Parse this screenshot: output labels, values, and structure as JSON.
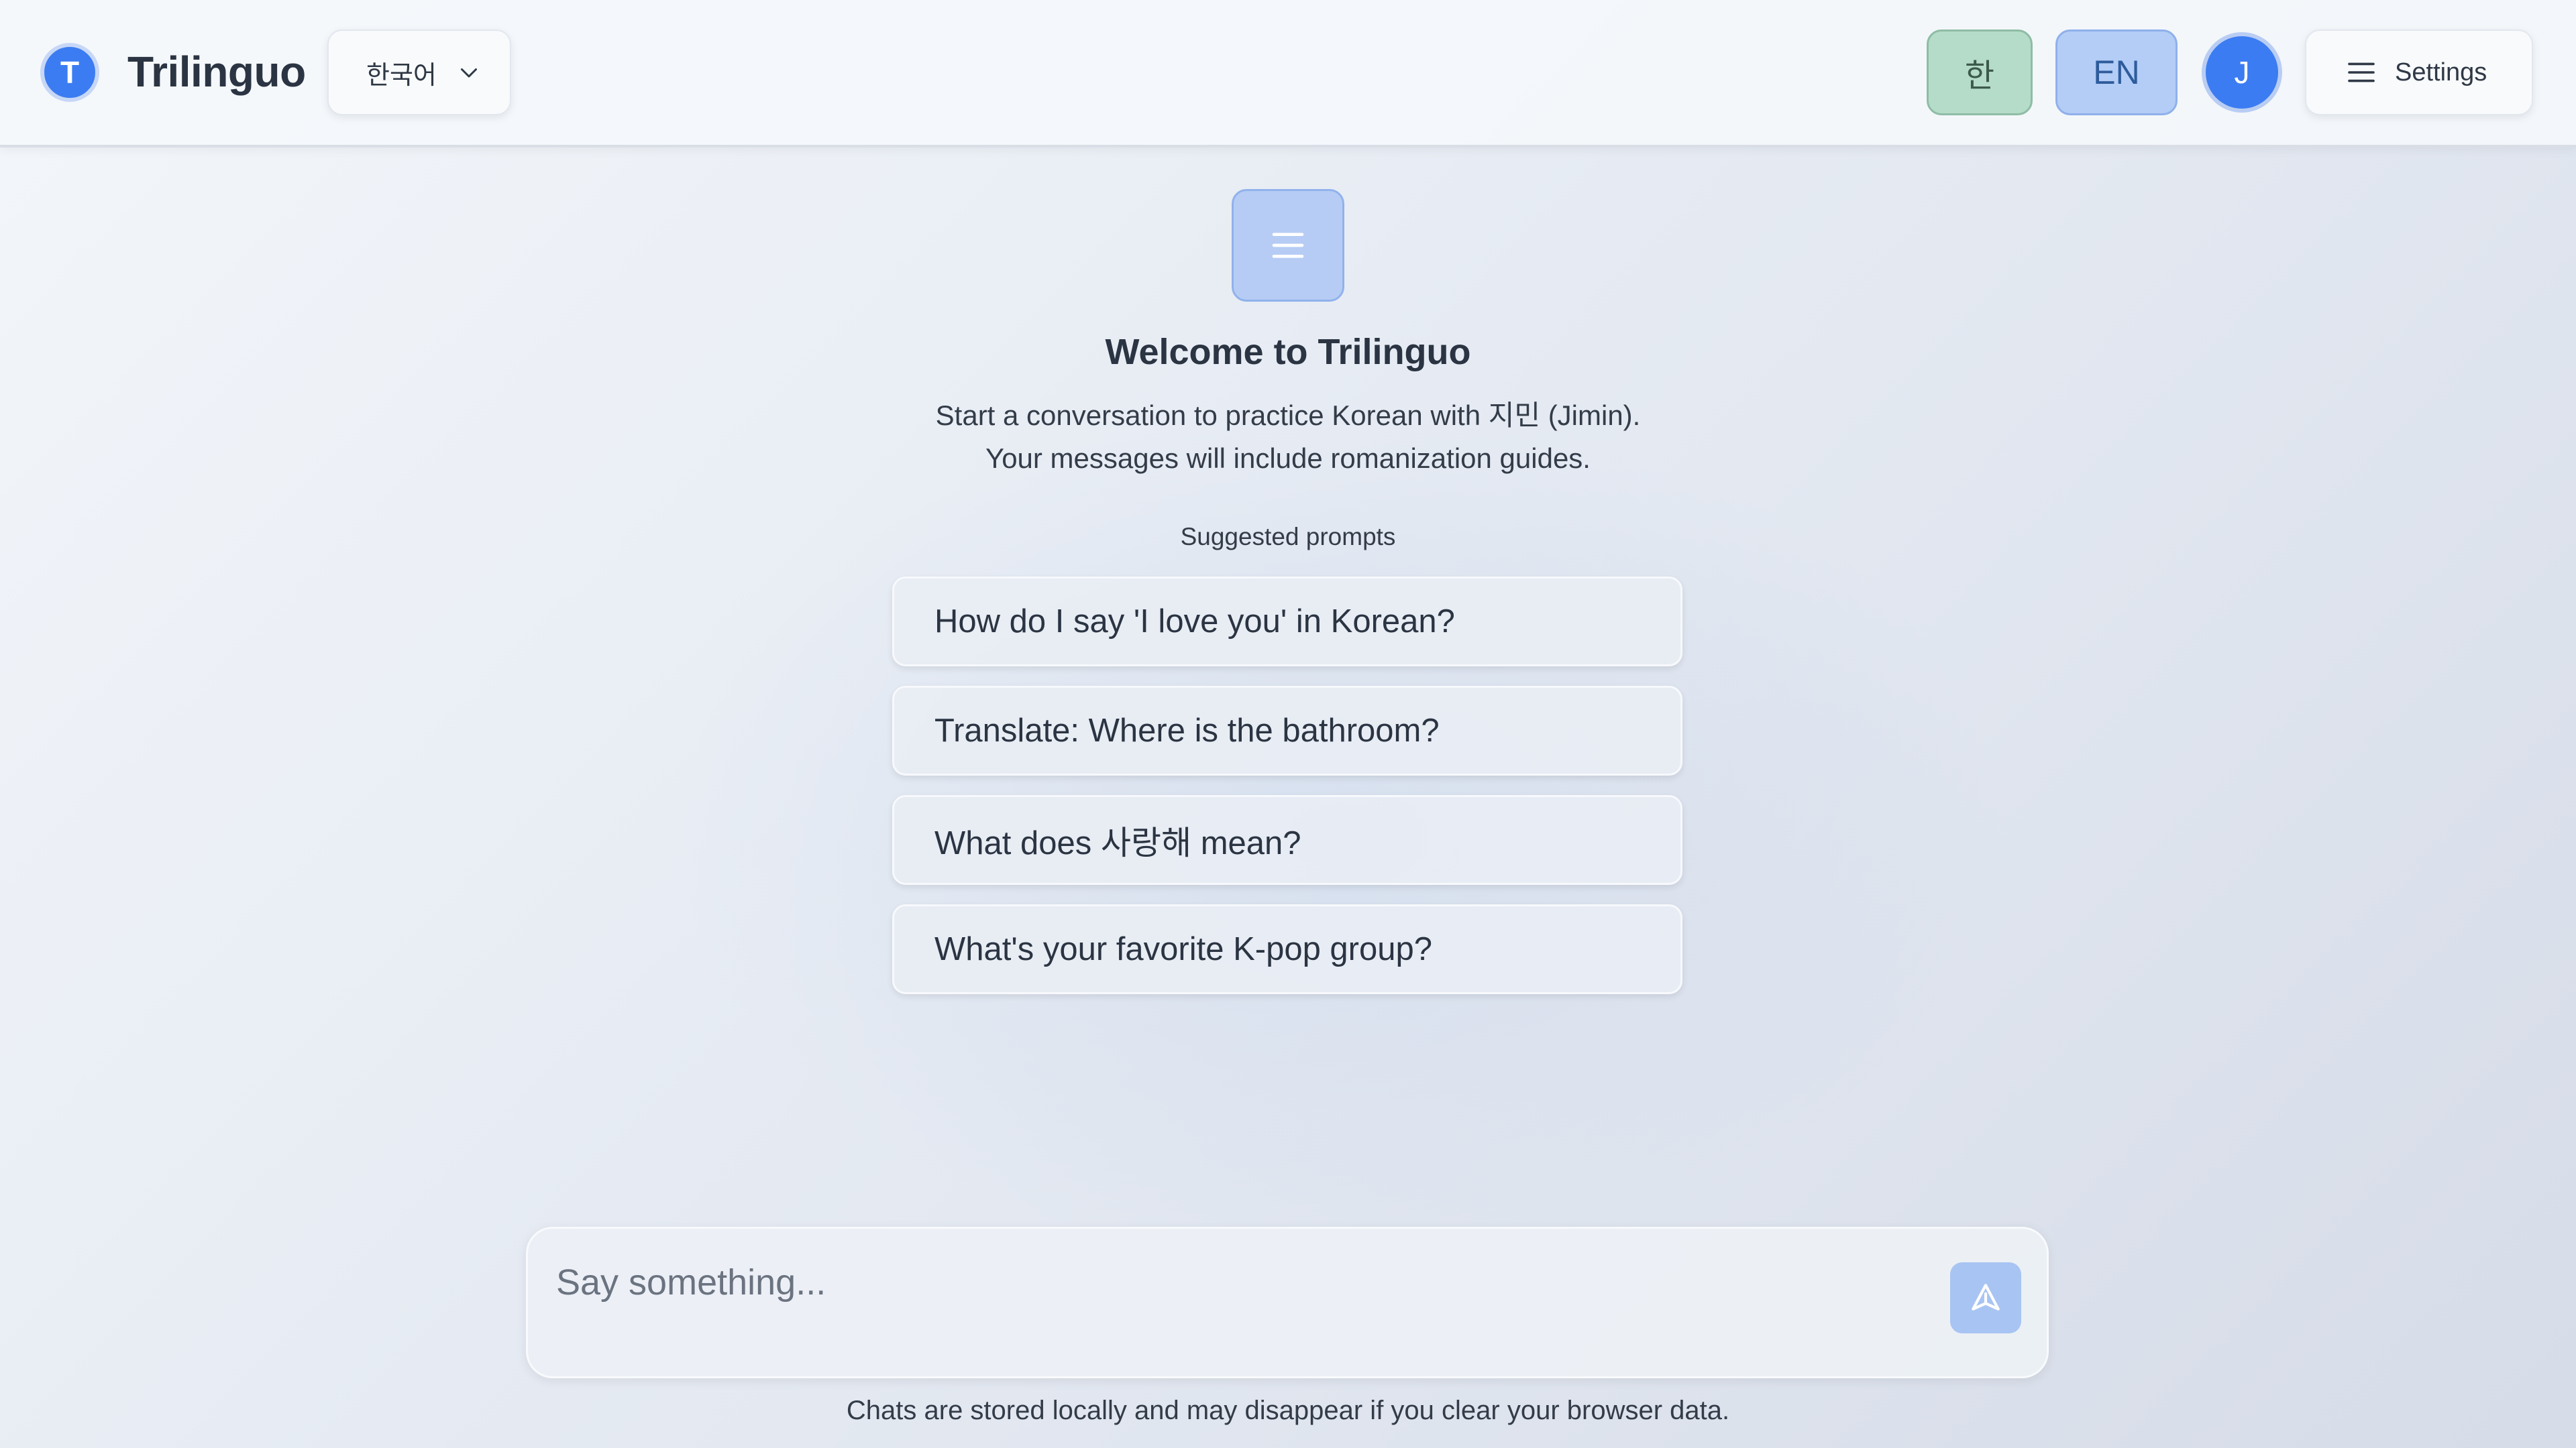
{
  "header": {
    "logo_letter": "T",
    "app_title": "Trilinguo",
    "language_select": {
      "selected": "한국어"
    },
    "korean_button": "한",
    "english_button": "EN",
    "avatar_letter": "J",
    "settings_label": "Settings"
  },
  "welcome": {
    "title": "Welcome to Trilinguo",
    "line1": "Start a conversation to practice Korean with 지민 (Jimin).",
    "line2": "Your messages will include romanization guides.",
    "suggested_heading": "Suggested prompts",
    "prompts": [
      "How do I say 'I love you' in Korean?",
      "Translate: Where is the bathroom?",
      "What does 사랑해 mean?",
      "What's your favorite K-pop group?"
    ]
  },
  "composer": {
    "placeholder": "Say something...",
    "value": ""
  },
  "footer": {
    "note": "Chats are stored locally and may disappear if you clear your browser data."
  },
  "icons": {
    "language_dropdown": "chevron-down-icon",
    "settings": "menu-icon",
    "welcome": "menu-icon",
    "send": "send-icon"
  },
  "colors": {
    "accent_blue": "#3b7cf2",
    "korean_button_bg": "#b5dcc8",
    "english_button_bg": "#b4cdf6",
    "send_button_bg": "#a8c4f3"
  }
}
